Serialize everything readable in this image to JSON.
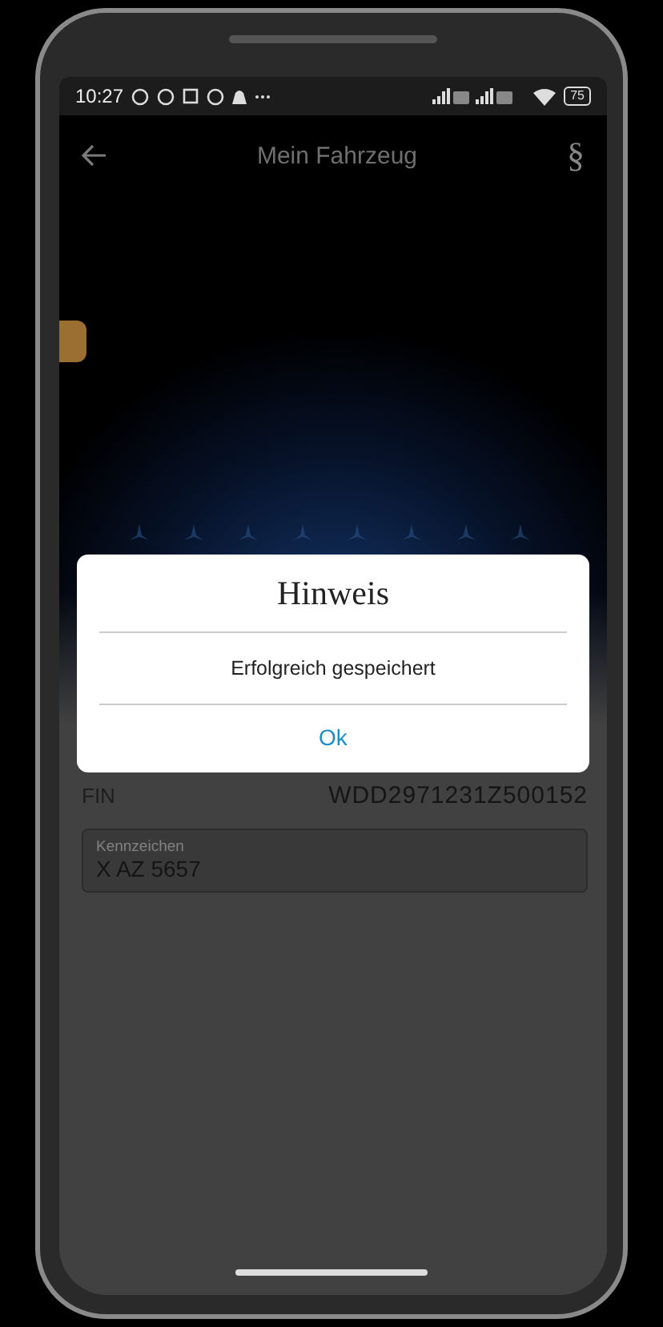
{
  "status_bar": {
    "time": "10:27",
    "battery": "75"
  },
  "app_bar": {
    "title": "Mein Fahrzeug",
    "action": "§"
  },
  "vehicle": {
    "fin_label": "FIN",
    "fin_value": "WDD2971231Z500152"
  },
  "plate_field": {
    "label": "Kennzeichen",
    "value": "X AZ 5657"
  },
  "dialog": {
    "title": "Hinweis",
    "message": "Erfolgreich gespeichert",
    "button": "Ok"
  }
}
